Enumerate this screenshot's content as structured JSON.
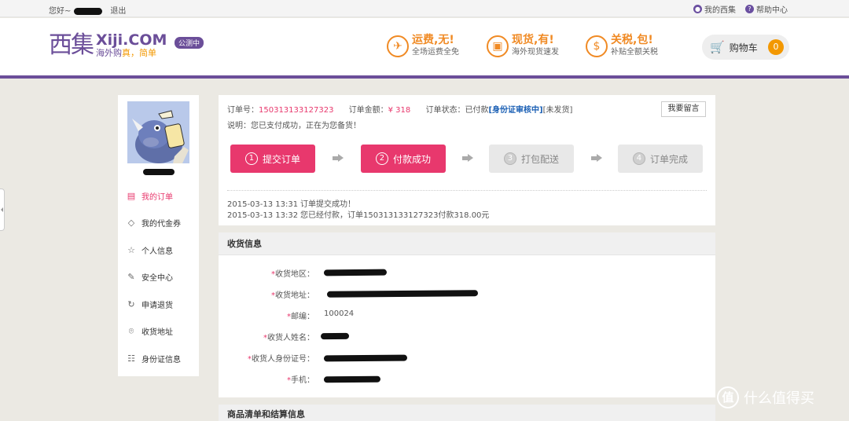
{
  "topbar": {
    "greeting": "您好~",
    "logout": "退出",
    "my_account": "我的西集",
    "help": "帮助中心"
  },
  "header": {
    "logo_cn": "西集",
    "logo_en": "Xiji.COM",
    "slogan_pre": "海外购",
    "slogan_hl": "真，简单",
    "beta": "公测中",
    "promos": [
      {
        "title": "运费,无!",
        "sub": "全场运费全免",
        "icon": "plane-icon"
      },
      {
        "title": "现货,有!",
        "sub": "海外现货速发",
        "icon": "box-icon"
      },
      {
        "title": "关税,包!",
        "sub": "补贴全额关税",
        "icon": "money-bag-icon"
      }
    ],
    "cart_label": "购物车",
    "cart_count": "0"
  },
  "sidebar": {
    "menu": [
      {
        "label": "我的订单",
        "icon": "document-icon",
        "active": true
      },
      {
        "label": "我的代金券",
        "icon": "tag-icon",
        "active": false
      },
      {
        "label": "个人信息",
        "icon": "star-icon",
        "active": false
      },
      {
        "label": "安全中心",
        "icon": "edit-icon",
        "active": false
      },
      {
        "label": "申请退货",
        "icon": "refresh-icon",
        "active": false
      },
      {
        "label": "收货地址",
        "icon": "location-icon",
        "active": false
      },
      {
        "label": "身份证信息",
        "icon": "id-card-icon",
        "active": false
      }
    ]
  },
  "order": {
    "no_label": "订单号：",
    "no_value": "150313133127323",
    "amount_label": "订单金额：",
    "amount_value": "¥ 318",
    "status_label": "订单状态：",
    "status_value": "已付款",
    "status_id": "[身份证审核中]",
    "status_ship": "[未发货]",
    "note": "说明：您已支付成功，正在为您备货！",
    "message_button": "我要留言",
    "steps": [
      {
        "num": "1",
        "label": "提交订单",
        "done": true
      },
      {
        "num": "2",
        "label": "付款成功",
        "done": true
      },
      {
        "num": "3",
        "label": "打包配送",
        "done": false
      },
      {
        "num": "4",
        "label": "订单完成",
        "done": false
      }
    ],
    "log": [
      {
        "time": "2015-03-13 13:31",
        "text": "订单提交成功！"
      },
      {
        "time": "2015-03-13 13:32",
        "text": "您已经付款，订单150313133127323付款318.00元"
      }
    ]
  },
  "shipping": {
    "title": "收货信息",
    "fields": [
      {
        "label": "收货地区：",
        "value": ""
      },
      {
        "label": "收货地址：",
        "value": ""
      },
      {
        "label": "邮编：",
        "value": "100024"
      },
      {
        "label": "收货人姓名：",
        "value": ""
      },
      {
        "label": "收货人身份证号：",
        "value": ""
      },
      {
        "label": "手机：",
        "value": ""
      }
    ]
  },
  "items": {
    "title": "商品清单和结算信息"
  },
  "watermark": {
    "glyph": "值",
    "text": "什么值得买"
  }
}
